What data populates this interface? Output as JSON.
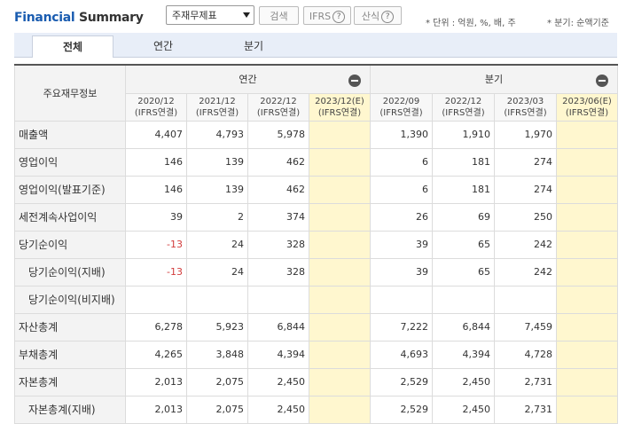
{
  "title_part1": "Financial",
  "title_part2": " Summary",
  "select_value": "주재무제표",
  "search_button": "검색",
  "ifrs_button": "IFRS",
  "calc_button": "산식",
  "help_glyph": "?",
  "unit_note": "* 단위 : 억원, %, 배, 주",
  "quarter_note": "* 분기: 순액기준",
  "tabs": [
    "전체",
    "연간",
    "분기"
  ],
  "row_header": "주요재무정보",
  "group_annual": "연간",
  "group_quarter": "분기",
  "columns": [
    {
      "period": "2020/12",
      "basis": "(IFRS연결)"
    },
    {
      "period": "2021/12",
      "basis": "(IFRS연결)"
    },
    {
      "period": "2022/12",
      "basis": "(IFRS연결)"
    },
    {
      "period": "2023/12(E)",
      "basis": "(IFRS연결)"
    },
    {
      "period": "2022/09",
      "basis": "(IFRS연결)"
    },
    {
      "period": "2022/12",
      "basis": "(IFRS연결)"
    },
    {
      "period": "2023/03",
      "basis": "(IFRS연결)"
    },
    {
      "period": "2023/06(E)",
      "basis": "(IFRS연결)"
    }
  ],
  "rows": [
    {
      "label": "매출액",
      "values": [
        "4,407",
        "4,793",
        "5,978",
        "",
        "1,390",
        "1,910",
        "1,970",
        ""
      ]
    },
    {
      "label": "영업이익",
      "values": [
        "146",
        "139",
        "462",
        "",
        "6",
        "181",
        "274",
        ""
      ]
    },
    {
      "label": "영업이익(발표기준)",
      "values": [
        "146",
        "139",
        "462",
        "",
        "6",
        "181",
        "274",
        ""
      ]
    },
    {
      "label": "세전계속사업이익",
      "values": [
        "39",
        "2",
        "374",
        "",
        "26",
        "69",
        "250",
        ""
      ]
    },
    {
      "label": "당기순이익",
      "values": [
        "-13",
        "24",
        "328",
        "",
        "39",
        "65",
        "242",
        ""
      ]
    },
    {
      "label": "당기순이익(지배)",
      "values": [
        "-13",
        "24",
        "328",
        "",
        "39",
        "65",
        "242",
        ""
      ]
    },
    {
      "label": "당기순이익(비지배)",
      "values": [
        "",
        "",
        "",
        "",
        "",
        "",
        "",
        ""
      ]
    },
    {
      "label": "자산총계",
      "values": [
        "6,278",
        "5,923",
        "6,844",
        "",
        "7,222",
        "6,844",
        "7,459",
        ""
      ]
    },
    {
      "label": "부채총계",
      "values": [
        "4,265",
        "3,848",
        "4,394",
        "",
        "4,693",
        "4,394",
        "4,728",
        ""
      ]
    },
    {
      "label": "자본총계",
      "values": [
        "2,013",
        "2,075",
        "2,450",
        "",
        "2,529",
        "2,450",
        "2,731",
        ""
      ]
    },
    {
      "label": "자본총계(지배)",
      "values": [
        "2,013",
        "2,075",
        "2,450",
        "",
        "2,529",
        "2,450",
        "2,731",
        ""
      ]
    }
  ]
}
